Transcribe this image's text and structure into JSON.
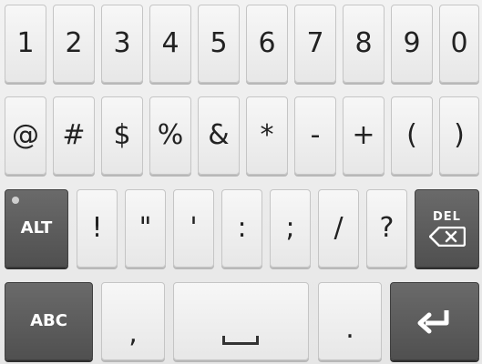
{
  "keyboard": {
    "row1": [
      "1",
      "2",
      "3",
      "4",
      "5",
      "6",
      "7",
      "8",
      "9",
      "0"
    ],
    "row2": [
      "@",
      "#",
      "$",
      "%",
      "&",
      "*",
      "-",
      "+",
      "(",
      ")"
    ],
    "row3": {
      "alt": "ALT",
      "keys": [
        "!",
        "\"",
        "'",
        ":",
        ";",
        "/",
        "?"
      ],
      "del": "DEL"
    },
    "row4": {
      "abc": "ABC",
      "comma": ",",
      "period": ".",
      "space_icon": "space-bar-icon",
      "enter_icon": "enter-arrow-icon"
    }
  }
}
